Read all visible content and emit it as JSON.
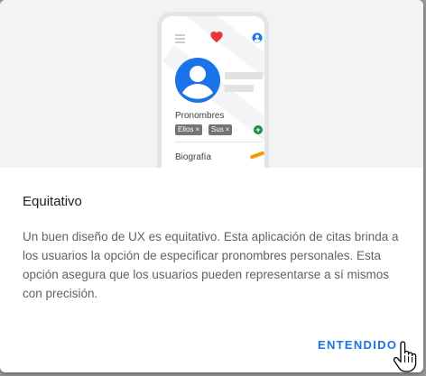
{
  "illustration": {
    "profile": {
      "pronouns_label": "Pronombres",
      "chips": [
        {
          "label": "Ellos",
          "remove": "×"
        },
        {
          "label": "Sus",
          "remove": "×"
        }
      ],
      "add_symbol": "+",
      "bio_label": "Biografía"
    },
    "icons": [
      "menu-icon",
      "heart-icon",
      "account-icon",
      "avatar-icon",
      "add-icon",
      "pencil-icon"
    ],
    "colors": {
      "heart": "#e53935",
      "avatar": "#1a73e8",
      "add": "#1e8e3e",
      "pencil": "#f29900",
      "chip": "#70757a"
    }
  },
  "dialog": {
    "title": "Equitativo",
    "body": "Un buen diseño de UX es equitativo. Esta aplicación de citas brinda a los usuarios la opción de especificar pronombres personales. Esta opción asegura que los usuarios pueden representarse a sí mismos con precisión.",
    "confirm_label": "ENTENDIDO"
  },
  "colors": {
    "accent": "#1a73e8",
    "title": "#202124",
    "body": "#5f6368"
  }
}
